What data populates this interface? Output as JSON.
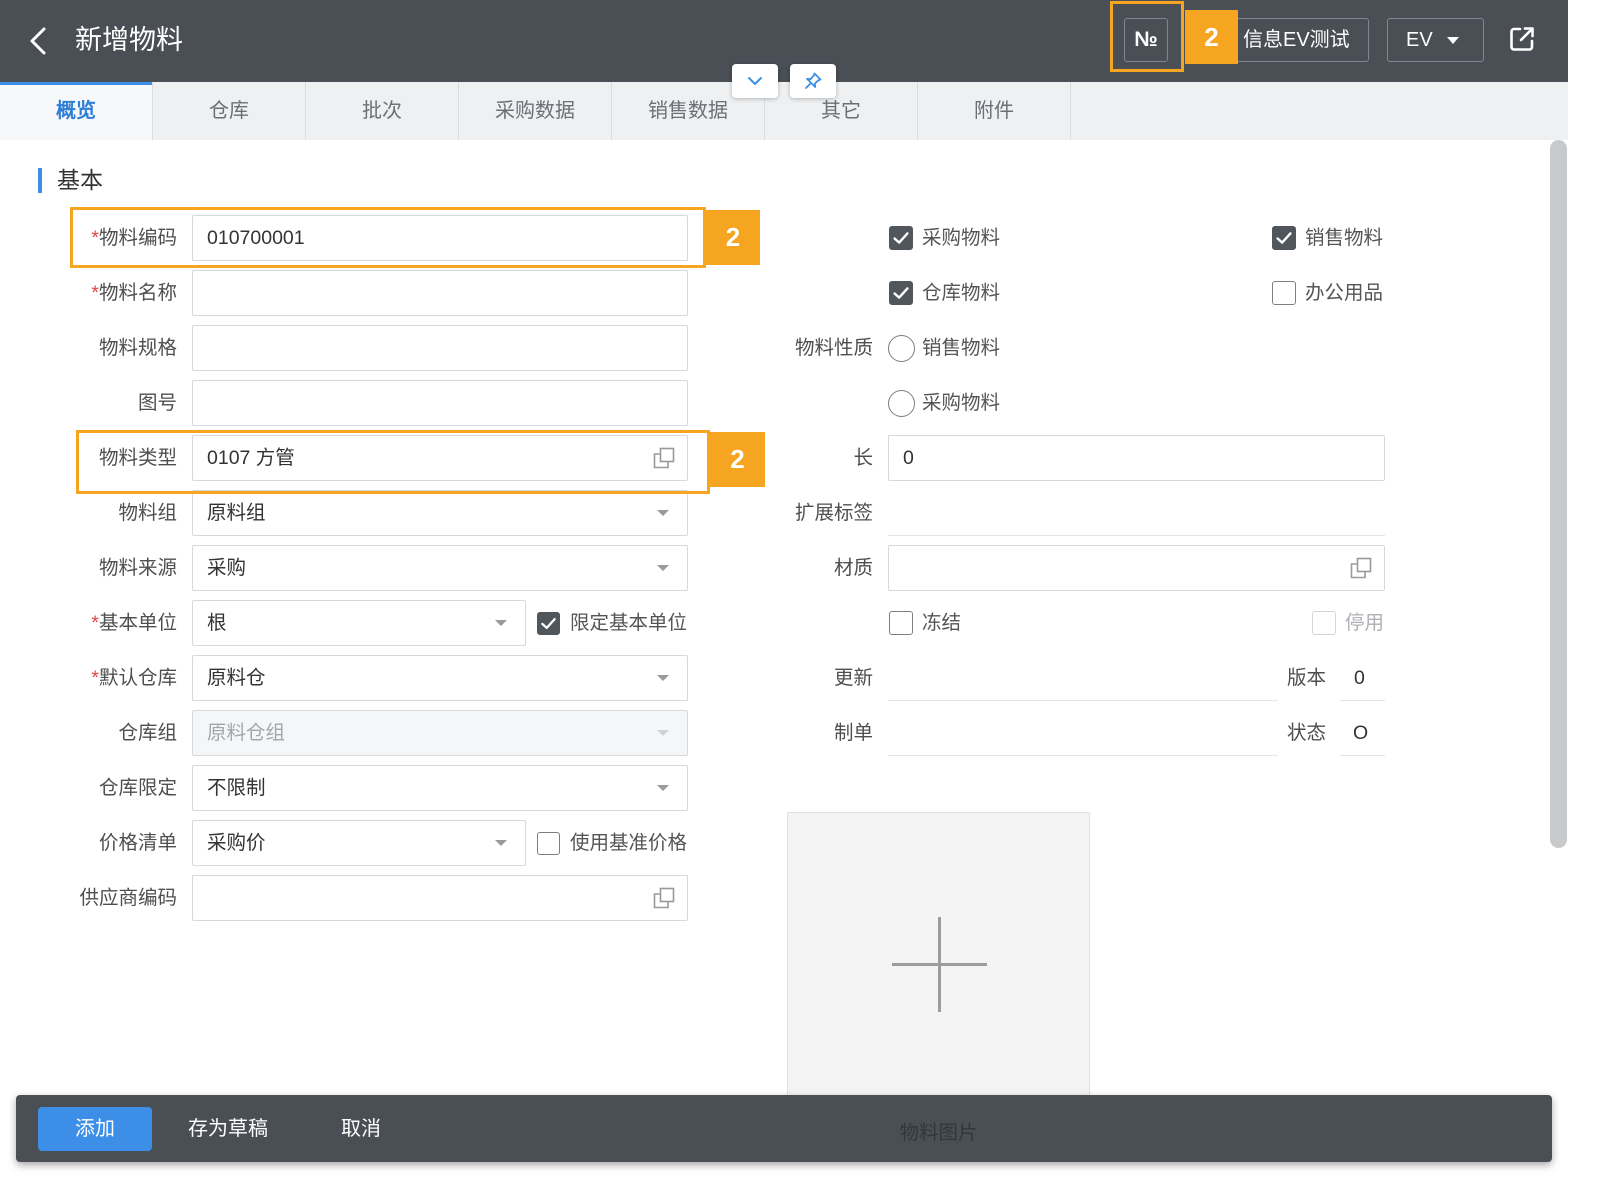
{
  "header": {
    "back_icon": "chevron-left-icon",
    "title": "新增物料",
    "number_button": "№",
    "info_button": "信息EV测试",
    "language_dropdown": "EV",
    "dropdown_icon": "caret-down-icon",
    "export_icon": "external-link-icon"
  },
  "floating_controls": {
    "collapse_icon": "chevron-down-icon",
    "pin_icon": "pin-icon"
  },
  "callouts": {
    "number_button": "2",
    "material_code": "2",
    "material_type": "2"
  },
  "tabs": {
    "active_index": 0,
    "items": [
      "概览",
      "仓库",
      "批次",
      "采购数据",
      "销售数据",
      "其它",
      "附件"
    ]
  },
  "section": {
    "title": "基本"
  },
  "required_mark": "*",
  "form_left": {
    "material_code": {
      "label": "物料编码",
      "required": true,
      "value": "010700001"
    },
    "material_name": {
      "label": "物料名称",
      "required": true,
      "value": ""
    },
    "specification": {
      "label": "物料规格",
      "value": ""
    },
    "drawing_no": {
      "label": "图号",
      "value": ""
    },
    "material_type": {
      "label": "物料类型",
      "value": "0107 方管",
      "icon": "lookup-icon"
    },
    "material_group": {
      "label": "物料组",
      "value": "原料组"
    },
    "material_source": {
      "label": "物料来源",
      "value": "采购"
    },
    "base_unit": {
      "label": "基本单位",
      "required": true,
      "value": "根",
      "restrict_label": "限定基本单位",
      "restrict_checked": true
    },
    "default_warehouse": {
      "label": "默认仓库",
      "required": true,
      "value": "原料仓"
    },
    "warehouse_group": {
      "label": "仓库组",
      "value": "原料仓组",
      "disabled": true
    },
    "warehouse_limit": {
      "label": "仓库限定",
      "value": "不限制"
    },
    "price_list": {
      "label": "价格清单",
      "value": "采购价",
      "use_base_price_label": "使用基准价格",
      "use_base_price_checked": false
    },
    "supplier_code": {
      "label": "供应商编码",
      "value": "",
      "icon": "lookup-icon"
    }
  },
  "form_right": {
    "purchase_material": {
      "label": "采购物料",
      "checked": true
    },
    "sales_material": {
      "label": "销售物料",
      "checked": true
    },
    "warehouse_material": {
      "label": "仓库物料",
      "checked": true
    },
    "office_supplies": {
      "label": "办公用品",
      "checked": false
    },
    "nature": {
      "label": "物料性质",
      "options": [
        "销售物料",
        "采购物料"
      ],
      "selected": null
    },
    "length": {
      "label": "长",
      "value": "0"
    },
    "extension_tags": {
      "label": "扩展标签",
      "value": ""
    },
    "texture": {
      "label": "材质",
      "value": "",
      "icon": "lookup-icon"
    },
    "frozen": {
      "label": "冻结",
      "checked": false
    },
    "deactivated": {
      "label": "停用",
      "checked": false,
      "disabled": true
    },
    "updated": {
      "label": "更新",
      "value": ""
    },
    "version": {
      "label": "版本",
      "value": "0"
    },
    "created_by": {
      "label": "制单",
      "value": ""
    },
    "status": {
      "label": "状态",
      "value": "O"
    }
  },
  "image_upload": {
    "caption": "物料图片",
    "icon": "plus-icon"
  },
  "footer": {
    "add_label": "添加",
    "save_draft_label": "存为草稿",
    "cancel_label": "取消"
  },
  "colors": {
    "header_bg": "#4a4f56",
    "accent": "#3c8ee6",
    "callout": "#f5a51f",
    "required": "#e64646"
  }
}
